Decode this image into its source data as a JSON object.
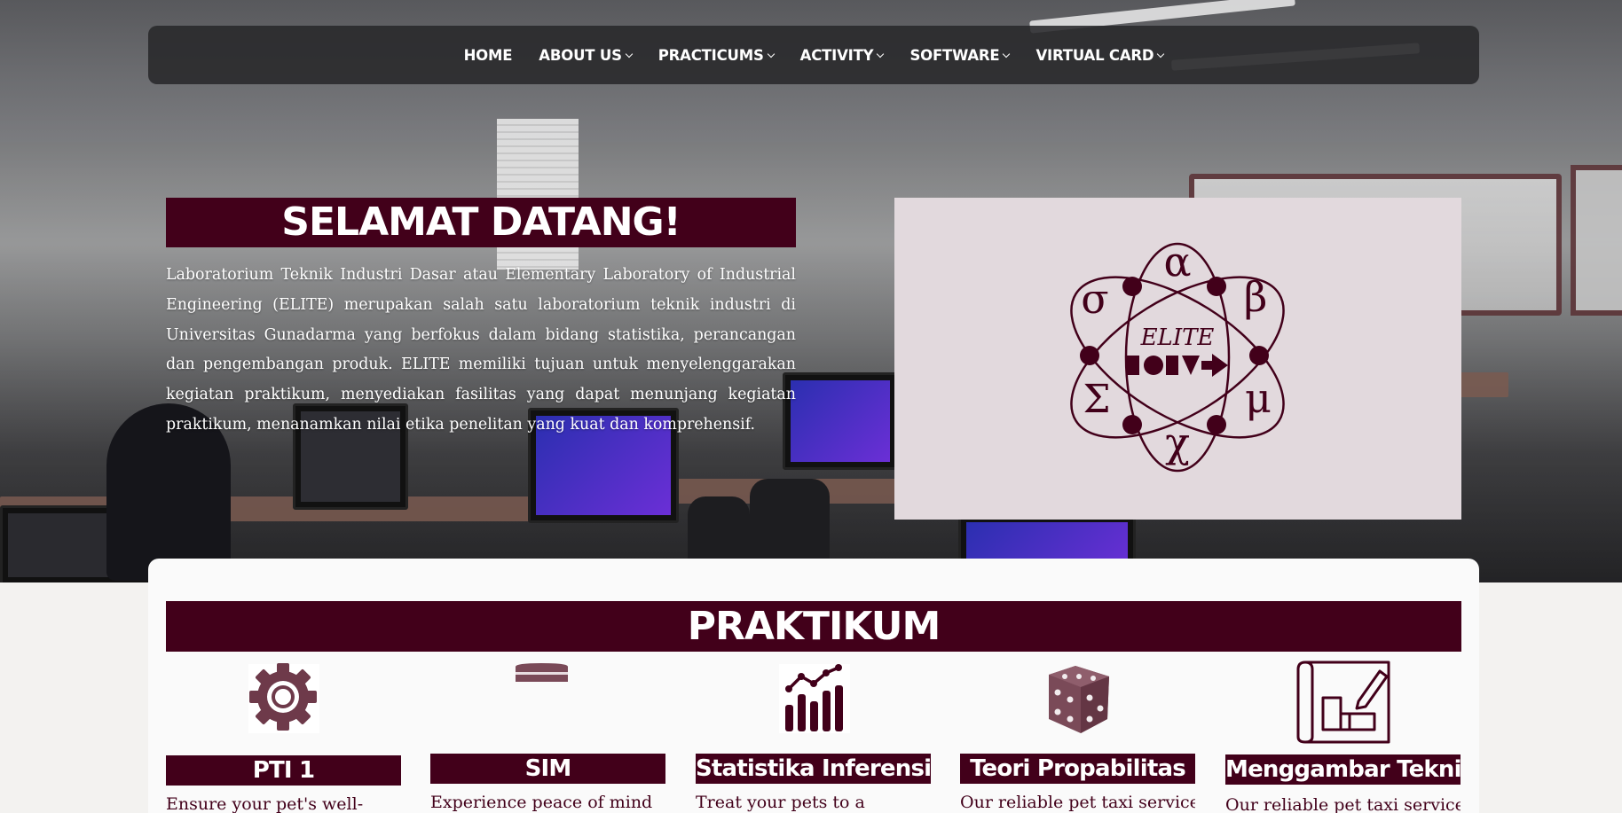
{
  "nav": {
    "items": [
      {
        "label": "HOME",
        "has_dropdown": false
      },
      {
        "label": "ABOUT US",
        "has_dropdown": true
      },
      {
        "label": "PRACTICUMS",
        "has_dropdown": true
      },
      {
        "label": "ACTIVITY",
        "has_dropdown": true
      },
      {
        "label": "SOFTWARE",
        "has_dropdown": true
      },
      {
        "label": "VIRTUAL CARD",
        "has_dropdown": true
      }
    ]
  },
  "hero": {
    "title": "SELAMAT DATANG!",
    "text": "Laboratorium Teknik Industri Dasar atau Elementary Laboratory of Industrial Engineering (ELITE) merupakan salah satu laboratorium teknik industri di Universitas Gunadarma yang berfokus dalam bidang statistika, perancangan dan pengembangan produk. ELITE memiliki tujuan untuk menyelenggarakan kegiatan praktikum, menyediakan fasilitas yang dapat menunjang kegiatan praktikum, menanamkan nilai etika penelitan yang kuat dan komprehensif.",
    "logo_text": "ELITE"
  },
  "praktikum": {
    "title": "PRAKTIKUM",
    "items": [
      {
        "label": "PTI 1",
        "desc": "Ensure your pet's well-",
        "icon": "gear-icon"
      },
      {
        "label": "SIM",
        "desc": "Experience peace of mind",
        "icon": "database-icon"
      },
      {
        "label": "Statistika Inferensia",
        "desc": "Treat your pets to a",
        "icon": "bar-chart-icon"
      },
      {
        "label": "Teori Propabilitas",
        "desc": "Our reliable pet taxi service",
        "icon": "dice-icon"
      },
      {
        "label": "Menggambar Teknik",
        "desc": "Our reliable pet taxi service",
        "icon": "blueprint-icon"
      }
    ]
  },
  "colors": {
    "primary": "#42001a",
    "icon": "#6e3a4a",
    "logo_bg": "#e2d9dd"
  }
}
